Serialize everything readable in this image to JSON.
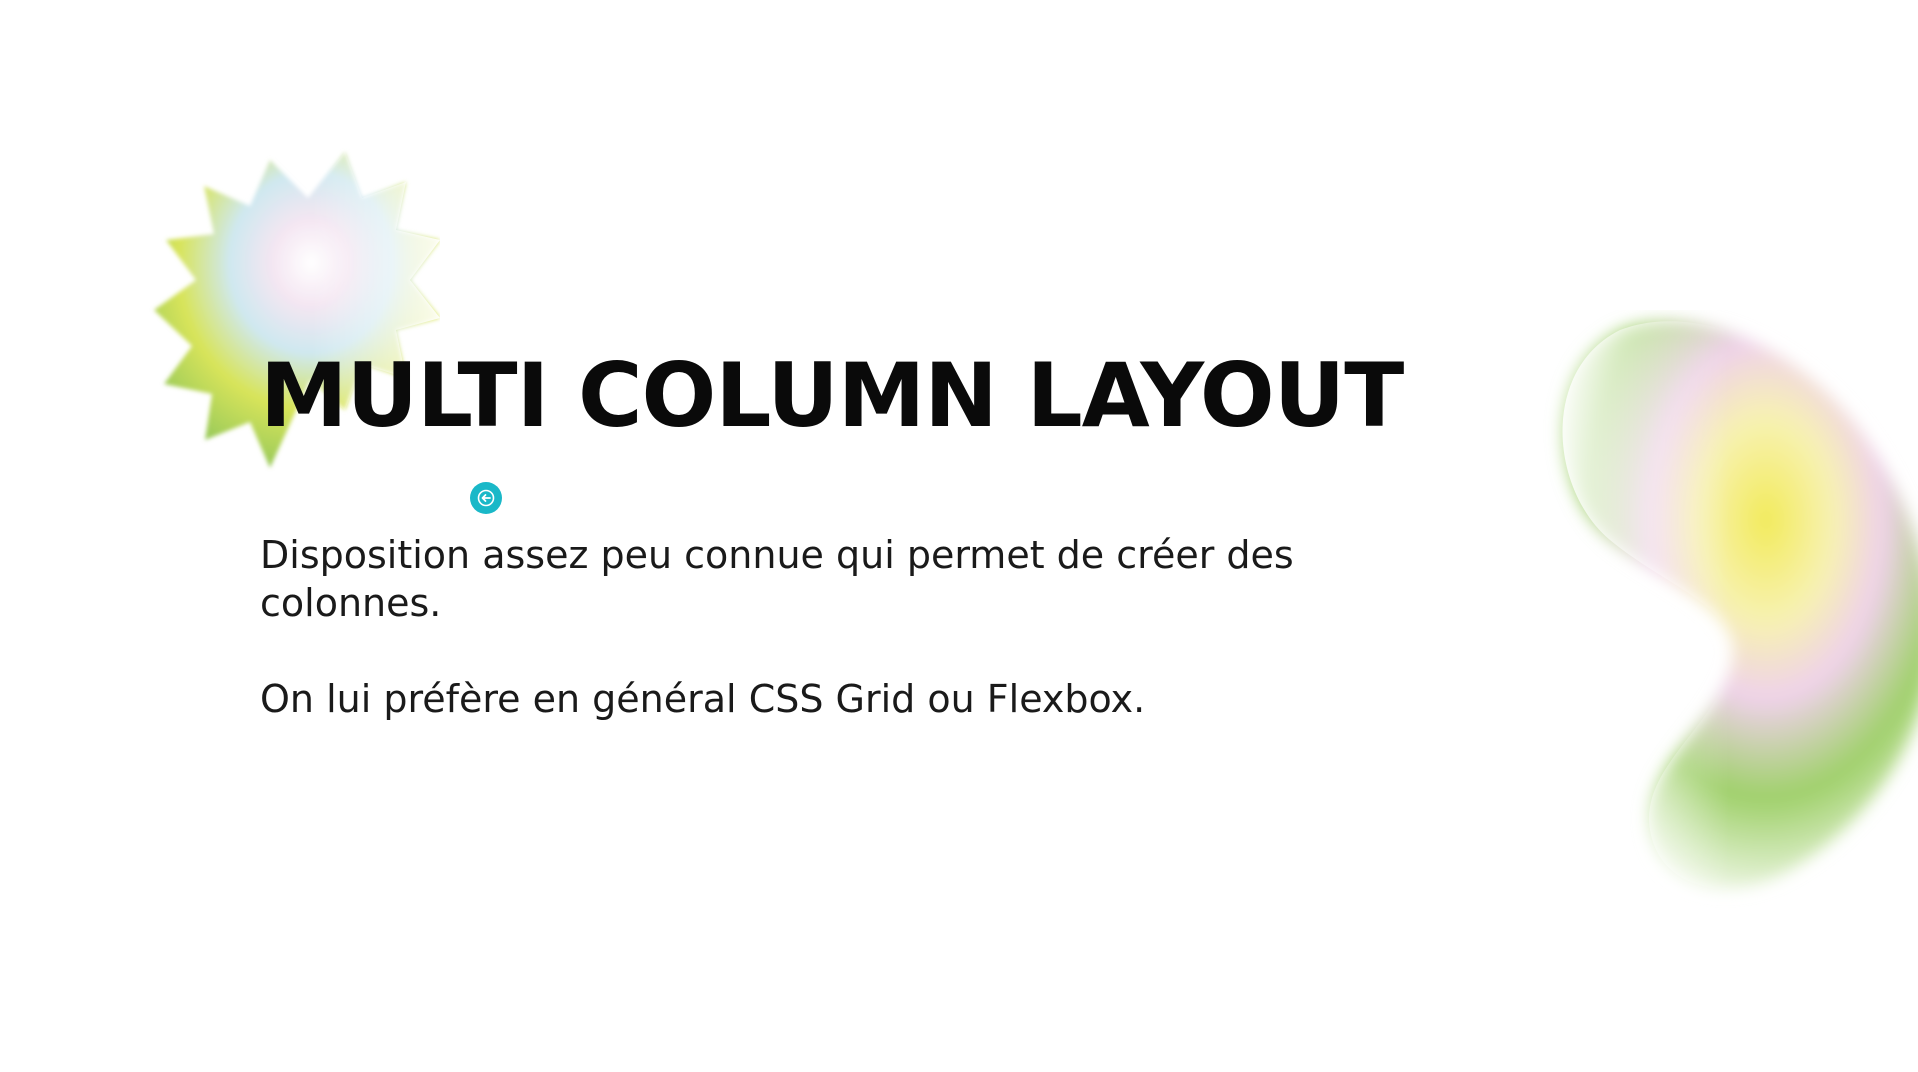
{
  "slide": {
    "title": "MULTI COLUMN LAYOUT",
    "paragraphs": [
      "Disposition assez peu connue qui permet de créer des colonnes.",
      "On lui préfère en général CSS Grid ou Flexbox."
    ],
    "back_button_icon": "arrow-left-icon"
  },
  "colors": {
    "accent": "#1ab8c8",
    "text": "#0a0a0a",
    "gradient_green": "#7fbf5a",
    "gradient_yellow": "#e8e04a",
    "gradient_pink": "#f0b8e0",
    "gradient_blue": "#cfe8f0"
  }
}
